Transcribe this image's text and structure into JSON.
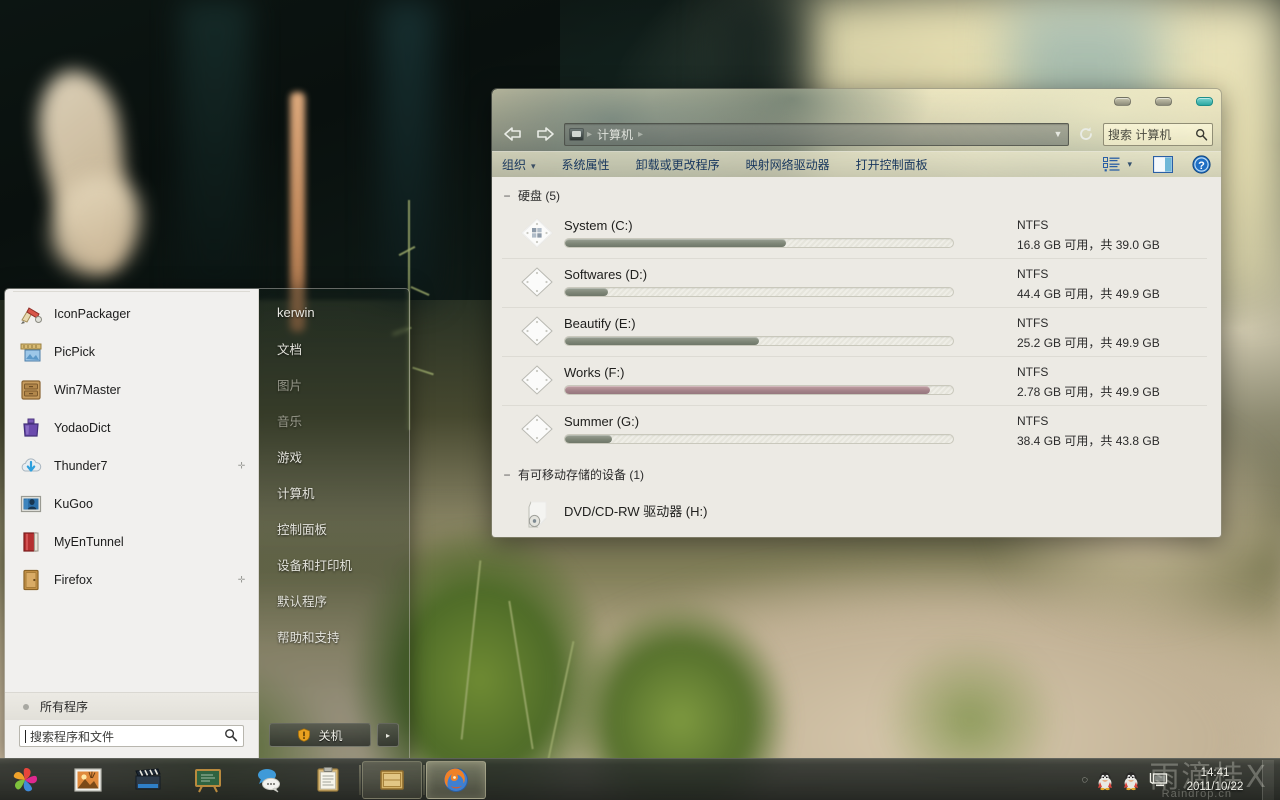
{
  "explorer": {
    "window_controls": [
      "minimize",
      "maximize",
      "close"
    ],
    "nav": {
      "back": "back-arrow",
      "forward": "forward-arrow"
    },
    "address": {
      "root_icon": "computer-icon",
      "crumb": "计算机",
      "dropdown": "▼",
      "refresh": "refresh-icon"
    },
    "search": {
      "placeholder": "搜索 计算机",
      "icon": "search-icon"
    },
    "commands": [
      {
        "label": "组织",
        "has_caret": true
      },
      {
        "label": "系统属性",
        "has_caret": false
      },
      {
        "label": "卸载或更改程序",
        "has_caret": false
      },
      {
        "label": "映射网络驱动器",
        "has_caret": false
      },
      {
        "label": "打开控制面板",
        "has_caret": false
      }
    ],
    "command_right": [
      "view-options-icon",
      "view-caret",
      "preview-pane-icon",
      "help-icon"
    ],
    "groups": [
      {
        "title": "硬盘 (5)",
        "toggle": "−",
        "drives": [
          {
            "name": "System (C:)",
            "fs": "NTFS",
            "free": "16.8 GB 可用，共 39.0 GB",
            "used_pct": 57,
            "low": false,
            "icon": "hard-drive-windows-icon"
          },
          {
            "name": "Softwares (D:)",
            "fs": "NTFS",
            "free": "44.4 GB 可用，共 49.9 GB",
            "used_pct": 11,
            "low": false,
            "icon": "hard-drive-icon"
          },
          {
            "name": "Beautify (E:)",
            "fs": "NTFS",
            "free": "25.2 GB 可用，共 49.9 GB",
            "used_pct": 50,
            "low": false,
            "icon": "hard-drive-icon"
          },
          {
            "name": "Works (F:)",
            "fs": "NTFS",
            "free": "2.78 GB 可用，共 49.9 GB",
            "used_pct": 94,
            "low": true,
            "icon": "hard-drive-icon"
          },
          {
            "name": "Summer (G:)",
            "fs": "NTFS",
            "free": "38.4 GB 可用，共 43.8 GB",
            "used_pct": 12,
            "low": false,
            "icon": "hard-drive-icon"
          }
        ]
      },
      {
        "title": "有可移动存储的设备 (1)",
        "toggle": "−",
        "drives": [
          {
            "name": "DVD/CD-RW 驱动器 (H:)",
            "fs": "",
            "free": "",
            "used_pct": 0,
            "low": false,
            "icon": "optical-drive-icon"
          }
        ]
      }
    ]
  },
  "start_menu": {
    "programs": [
      {
        "label": "IconPackager",
        "icon": "iconpackager-icon",
        "jump": false
      },
      {
        "label": "PicPick",
        "icon": "picpick-icon",
        "jump": false
      },
      {
        "label": "Win7Master",
        "icon": "win7master-icon",
        "jump": false
      },
      {
        "label": "YodaoDict",
        "icon": "yodaodict-icon",
        "jump": false
      },
      {
        "label": "Thunder7",
        "icon": "thunder7-icon",
        "jump": true
      },
      {
        "label": "KuGoo",
        "icon": "kugoo-icon",
        "jump": false
      },
      {
        "label": "MyEnTunnel",
        "icon": "myentunnel-icon",
        "jump": false
      },
      {
        "label": "Firefox",
        "icon": "firefox-icon",
        "jump": true
      }
    ],
    "all_programs": "所有程序",
    "search_placeholder": "搜索程序和文件",
    "search_value": "",
    "user": "kerwin",
    "right_items": [
      {
        "label": "文档",
        "dim": false
      },
      {
        "label": "图片",
        "dim": true
      },
      {
        "label": "音乐",
        "dim": true
      },
      {
        "label": "游戏",
        "dim": false
      },
      {
        "label": "计算机",
        "dim": false
      },
      {
        "label": "控制面板",
        "dim": false
      },
      {
        "label": "设备和打印机",
        "dim": false
      },
      {
        "label": "默认程序",
        "dim": false
      },
      {
        "label": "帮助和支持",
        "dim": false
      }
    ],
    "shutdown": {
      "label": "关机",
      "icon": "shield-icon",
      "arrow": "▸"
    }
  },
  "taskbar": {
    "start_button": "start-orb-icon",
    "items": [
      {
        "name": "photo-viewer",
        "icon": "photo-icon",
        "state": "pinned"
      },
      {
        "name": "video-player",
        "icon": "clapperboard-icon",
        "state": "pinned"
      },
      {
        "name": "presentation",
        "icon": "blackboard-icon",
        "state": "pinned"
      },
      {
        "name": "messenger",
        "icon": "chat-bubbles-icon",
        "state": "pinned"
      },
      {
        "name": "notes",
        "icon": "clipboard-icon",
        "state": "pinned"
      },
      {
        "name": "windows-explorer",
        "icon": "folder-icon",
        "state": "running"
      },
      {
        "name": "firefox",
        "icon": "firefox-icon",
        "state": "active"
      }
    ],
    "tray": [
      "qq-icon",
      "qq-icon",
      "network-icon"
    ],
    "clock": {
      "time": "14:41",
      "date": "2011/10/22"
    },
    "watermark": "雨滴桂X",
    "watermark_sub": "Raindrop.cn"
  }
}
